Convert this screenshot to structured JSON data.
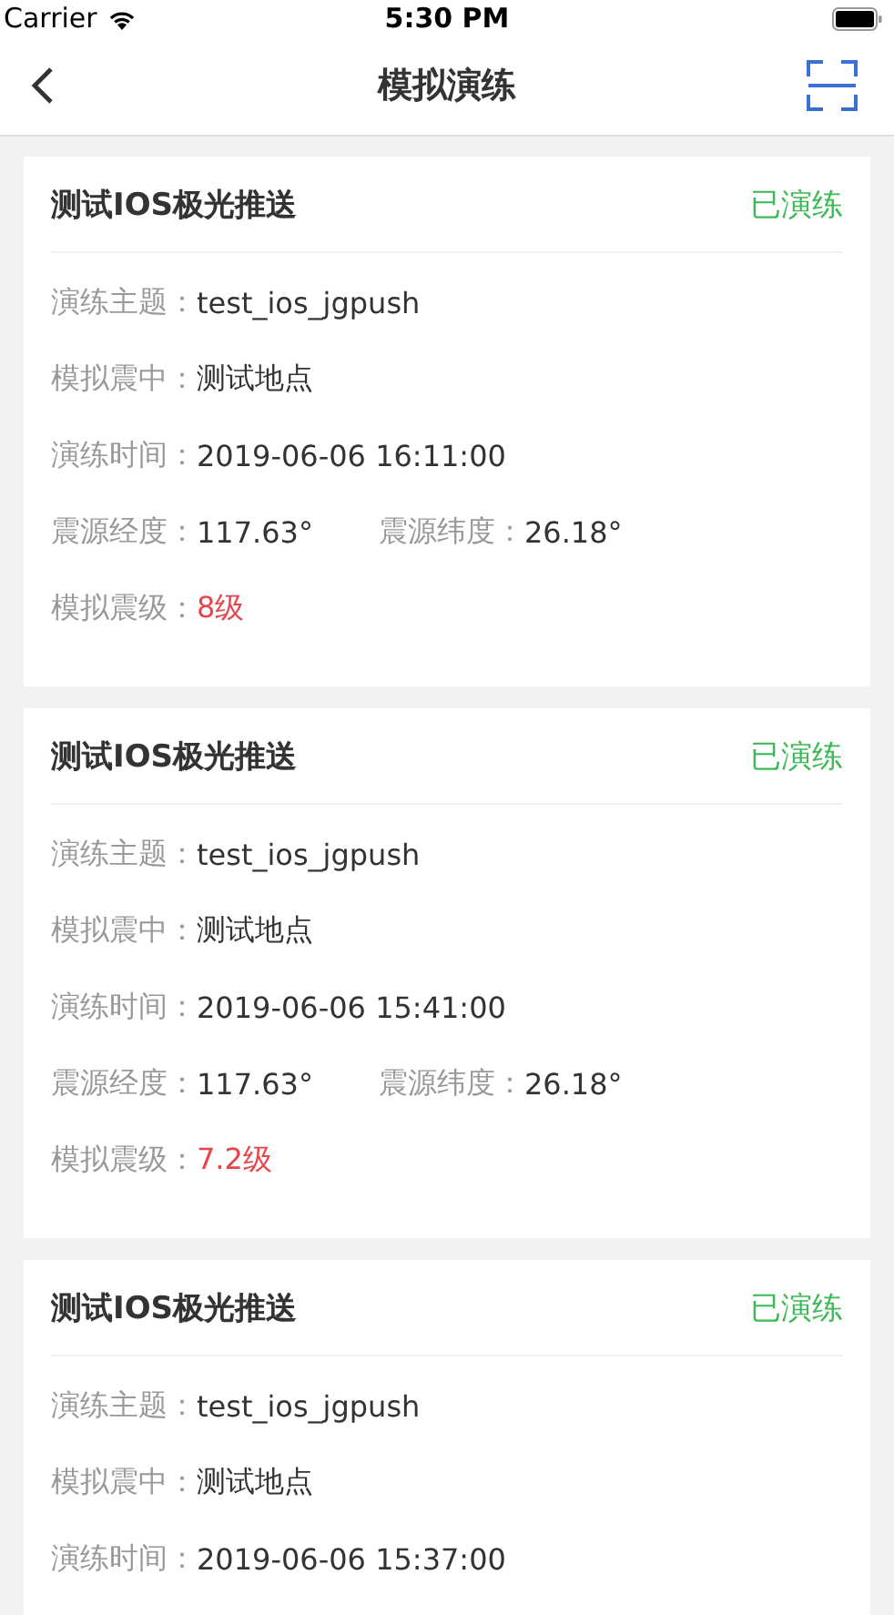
{
  "status_bar": {
    "carrier": "Carrier",
    "time": "5:30 PM"
  },
  "nav": {
    "title": "模拟演练"
  },
  "cards": [
    {
      "title": "测试IOS极光推送",
      "status": "已演练",
      "rows": [
        [
          {
            "label": "演练主题：",
            "value": "test_ios_jgpush",
            "kind": "normal"
          }
        ],
        [
          {
            "label": "模拟震中：",
            "value": "测试地点",
            "kind": "normal"
          }
        ],
        [
          {
            "label": "演练时间：",
            "value": "2019-06-06 16:11:00",
            "kind": "normal"
          }
        ],
        [
          {
            "label": "震源经度：",
            "value": "117.63°",
            "kind": "normal"
          },
          {
            "label": "震源纬度：",
            "value": "26.18°",
            "kind": "normal"
          }
        ],
        [
          {
            "label": "模拟震级：",
            "value": "8级",
            "kind": "alert"
          }
        ]
      ]
    },
    {
      "title": "测试IOS极光推送",
      "status": "已演练",
      "rows": [
        [
          {
            "label": "演练主题：",
            "value": "test_ios_jgpush",
            "kind": "normal"
          }
        ],
        [
          {
            "label": "模拟震中：",
            "value": "测试地点",
            "kind": "normal"
          }
        ],
        [
          {
            "label": "演练时间：",
            "value": "2019-06-06 15:41:00",
            "kind": "normal"
          }
        ],
        [
          {
            "label": "震源经度：",
            "value": "117.63°",
            "kind": "normal"
          },
          {
            "label": "震源纬度：",
            "value": "26.18°",
            "kind": "normal"
          }
        ],
        [
          {
            "label": "模拟震级：",
            "value": "7.2级",
            "kind": "alert"
          }
        ]
      ]
    },
    {
      "title": "测试IOS极光推送",
      "status": "已演练",
      "rows": [
        [
          {
            "label": "演练主题：",
            "value": "test_ios_jgpush",
            "kind": "normal"
          }
        ],
        [
          {
            "label": "模拟震中：",
            "value": "测试地点",
            "kind": "normal"
          }
        ],
        [
          {
            "label": "演练时间：",
            "value": "2019-06-06 15:37:00",
            "kind": "normal"
          }
        ]
      ]
    }
  ]
}
